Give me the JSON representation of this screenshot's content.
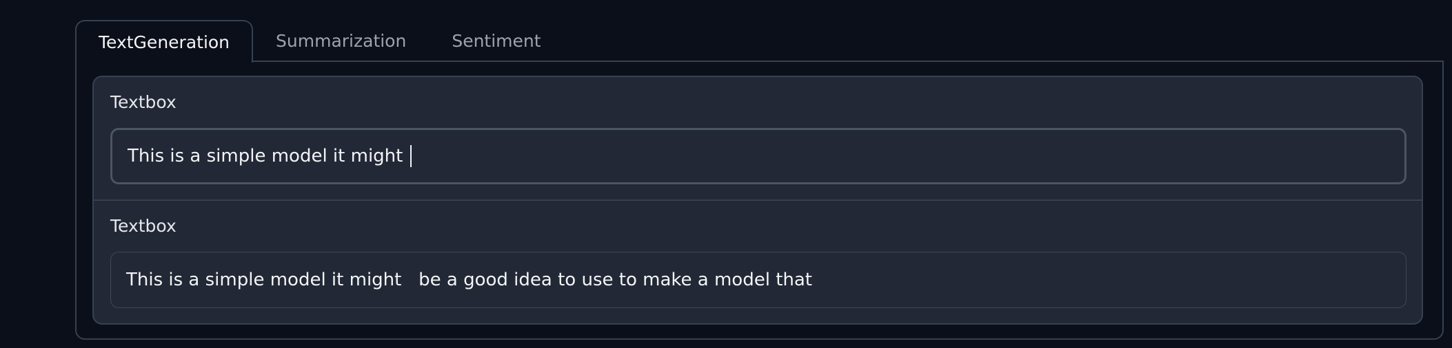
{
  "tabs": [
    {
      "label": "TextGeneration",
      "selected": true
    },
    {
      "label": "Summarization",
      "selected": false
    },
    {
      "label": "Sentiment",
      "selected": false
    }
  ],
  "panel": {
    "input": {
      "label": "Textbox",
      "value": "This is a simple model it might "
    },
    "output": {
      "label": "Textbox",
      "value": "This is a simple model it might   be a good idea to use to make a model that"
    }
  },
  "colors": {
    "background": "#0b0f19",
    "block": "#222836",
    "border": "#374151",
    "text": "#f3f4f6",
    "muted": "#9ca3af"
  }
}
